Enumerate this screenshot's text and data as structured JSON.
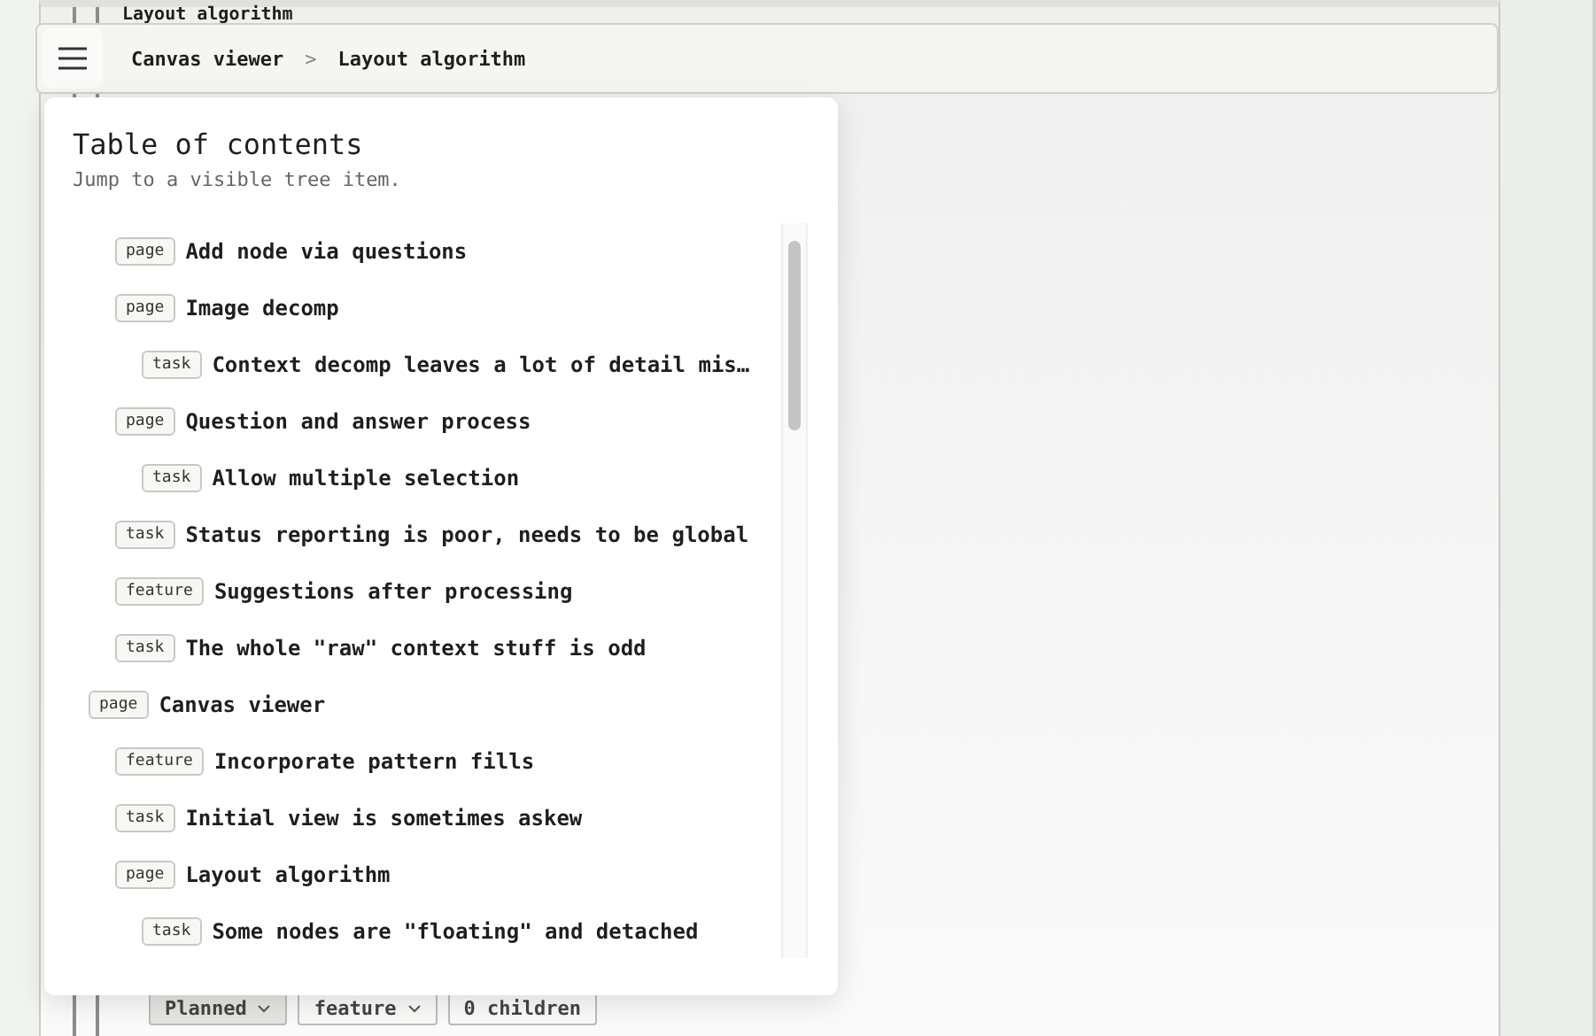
{
  "page": {
    "title": "Layout algorithm",
    "chips": [
      {
        "kind": "dropdown",
        "label": "Planned",
        "selected": true
      },
      {
        "kind": "dropdown",
        "label": "feature",
        "selected": false
      },
      {
        "kind": "count",
        "label": "0 children",
        "selected": false
      }
    ]
  },
  "toolbar": {
    "breadcrumbs": [
      "Canvas viewer",
      "Layout algorithm"
    ],
    "separator": ">"
  },
  "toc": {
    "title": "Table of contents",
    "subtitle": "Jump to a visible tree item.",
    "items": [
      {
        "children": [
          {
            "badge": "page",
            "label": "Add node via questions"
          },
          {
            "badge": "page",
            "label": "Image decomp",
            "children": [
              {
                "badge": "task",
                "label": "Context decomp leaves a lot of detail mis…"
              }
            ]
          },
          {
            "badge": "page",
            "label": "Question and answer process",
            "children": [
              {
                "badge": "task",
                "label": "Allow multiple selection"
              }
            ]
          },
          {
            "badge": "task",
            "label": "Status reporting is poor, needs to be global"
          },
          {
            "badge": "feature",
            "label": "Suggestions after processing"
          },
          {
            "badge": "task",
            "label": "The whole \"raw\" context stuff is odd"
          }
        ]
      },
      {
        "badge": "page",
        "label": "Canvas viewer",
        "children": [
          {
            "badge": "feature",
            "label": "Incorporate pattern fills"
          },
          {
            "badge": "task",
            "label": "Initial view is sometimes askew"
          },
          {
            "badge": "page",
            "label": "Layout algorithm",
            "children": [
              {
                "badge": "task",
                "label": "Some nodes are \"floating\" and detached"
              }
            ]
          }
        ]
      }
    ]
  }
}
